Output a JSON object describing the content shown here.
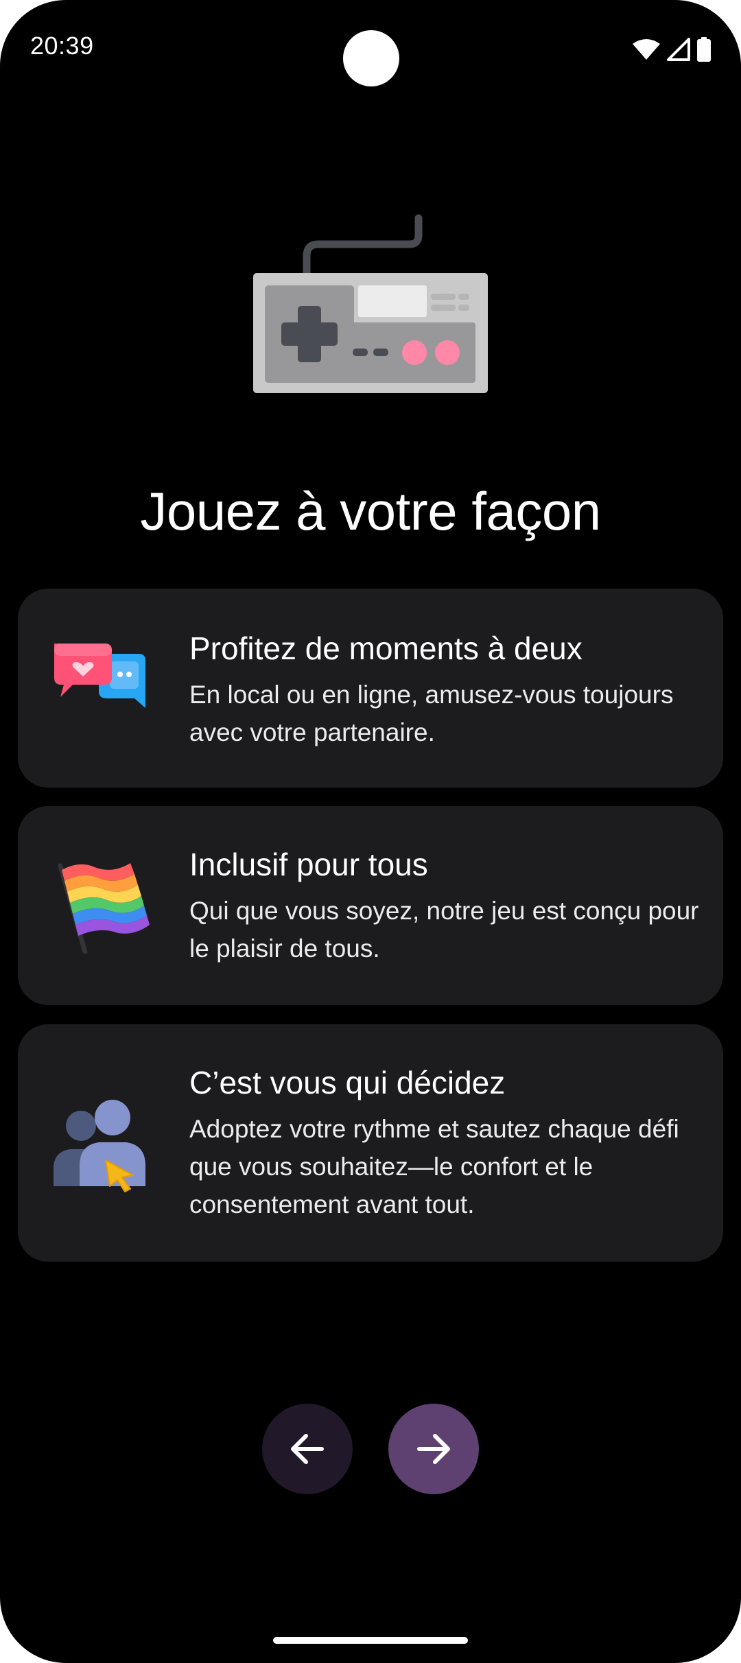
{
  "status_bar": {
    "time": "20:39",
    "icons": [
      "wifi-icon",
      "cellular-signal-icon",
      "battery-icon"
    ]
  },
  "hero": {
    "icon": "game-controller-icon"
  },
  "headline": "Jouez à votre façon",
  "features": [
    {
      "icon": "chat-bubbles-icon",
      "title": "Profitez de moments à deux",
      "description": "En local ou en ligne, amusez-vous toujours avec votre partenaire."
    },
    {
      "icon": "rainbow-flag-icon",
      "title": "Inclusif pour tous",
      "description": "Qui que vous soyez, notre jeu est conçu pour le plaisir de tous."
    },
    {
      "icon": "users-cursor-icon",
      "title": "C’est vous qui décidez",
      "description": "Adoptez votre rythme et sautez chaque défi que vous souhaitez—le confort et le consentement avant tout."
    }
  ],
  "navigation": {
    "back_icon": "arrow-left-icon",
    "next_icon": "arrow-right-icon"
  },
  "colors": {
    "background": "#000000",
    "card": "#1c1c1e",
    "back_button": "#211829",
    "next_button": "#5e4170",
    "text": "#ffffff"
  }
}
